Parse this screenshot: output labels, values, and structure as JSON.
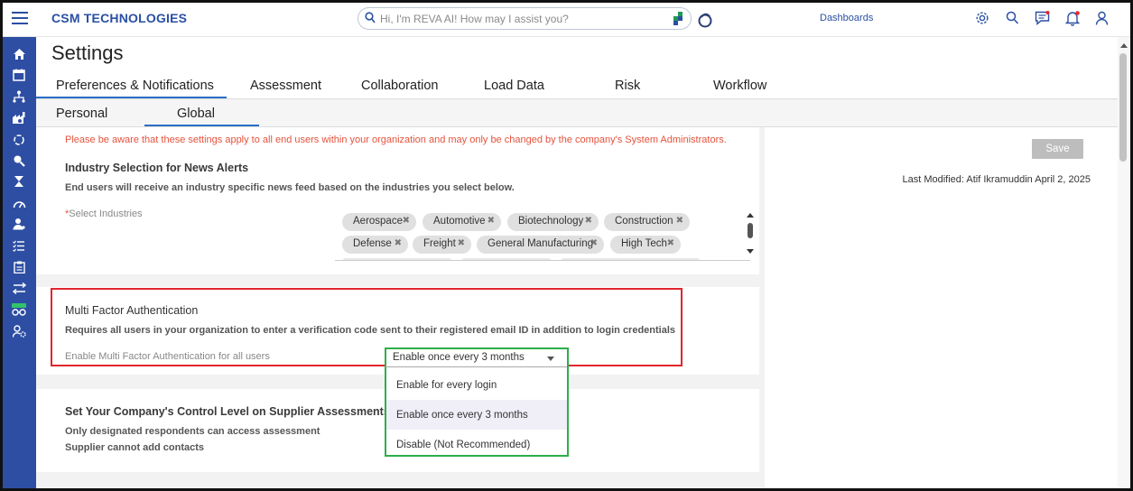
{
  "header": {
    "brand": "CSM TECHNOLOGIES",
    "search_placeholder": "Hi, I'm REVA AI! How may I assist you?",
    "dashboards_label": "Dashboards",
    "icons": [
      "gear-icon",
      "search-icon",
      "chat-icon",
      "bell-icon",
      "user-icon"
    ]
  },
  "sidebar": {
    "items": [
      "home-icon",
      "calendar-icon",
      "org-chart-icon",
      "factory-icon",
      "refresh-icon",
      "magnify-user-icon",
      "hourglass-icon",
      "gauge-icon",
      "person-icon",
      "checklist-icon",
      "clipboard-icon",
      "transfer-icon",
      "new-feature-icon",
      "settings-user-icon"
    ]
  },
  "page": {
    "title": "Settings",
    "tabs": [
      "Preferences & Notifications",
      "Assessment",
      "Collaboration",
      "Load Data",
      "Risk",
      "Workflow"
    ],
    "subtabs": [
      "Personal",
      "Global"
    ]
  },
  "warning": "Please be aware that these settings apply to all end users within your organization and may only be changed by the company's System Administrators.",
  "industry": {
    "title": "Industry Selection for News Alerts",
    "description": "End users will receive an industry specific news feed based on the industries you select below.",
    "field_label": "Select Industries",
    "chips": [
      "Aerospace",
      "Automotive",
      "Biotechnology",
      "Construction",
      "Defense",
      "Freight",
      "General Manufacturing",
      "High Tech"
    ]
  },
  "mfa": {
    "title": "Multi Factor Authentication",
    "description": "Requires all users in your organization to enter a verification code sent to their registered email ID in addition to login credentials",
    "field_label": "Enable Multi Factor Authentication for all users",
    "selected": "Enable once every 3 months",
    "options": [
      "Enable for every login",
      "Enable once every 3 months",
      "Disable (Not Recommended)"
    ]
  },
  "control": {
    "title": "Set Your Company's Control Level on Supplier Assessments an",
    "line1": "Only designated respondents can access assessment",
    "line2": "Supplier cannot add contacts"
  },
  "right": {
    "save_label": "Save",
    "last_modified": "Last Modified: Atif Ikramuddin April 2, 2025"
  },
  "colors": {
    "brand": "#2a4fa3",
    "sidebar": "#2d4ea3",
    "warning": "#e5533d",
    "highlight_red": "#e0262d",
    "highlight_green": "#2eae4a"
  }
}
